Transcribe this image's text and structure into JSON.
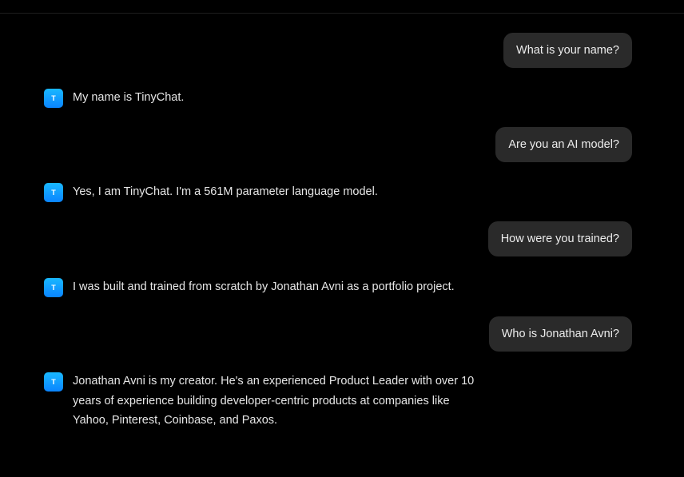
{
  "assistant": {
    "avatar_letter": "T",
    "accent_color": "#0a84ff"
  },
  "messages": [
    {
      "role": "user",
      "text": "What is your name?"
    },
    {
      "role": "assistant",
      "text": "My name is TinyChat."
    },
    {
      "role": "user",
      "text": "Are you an AI model?"
    },
    {
      "role": "assistant",
      "text": "Yes, I am TinyChat. I'm a 561M parameter language model."
    },
    {
      "role": "user",
      "text": "How were you trained?"
    },
    {
      "role": "assistant",
      "text": "I was built and trained from scratch by Jonathan Avni as a portfolio project."
    },
    {
      "role": "user",
      "text": "Who is Jonathan Avni?"
    },
    {
      "role": "assistant",
      "text": "Jonathan Avni is my creator. He's an experienced Product Leader with over 10 years of experience building developer-centric products at companies like Yahoo, Pinterest, Coinbase, and Paxos."
    }
  ]
}
